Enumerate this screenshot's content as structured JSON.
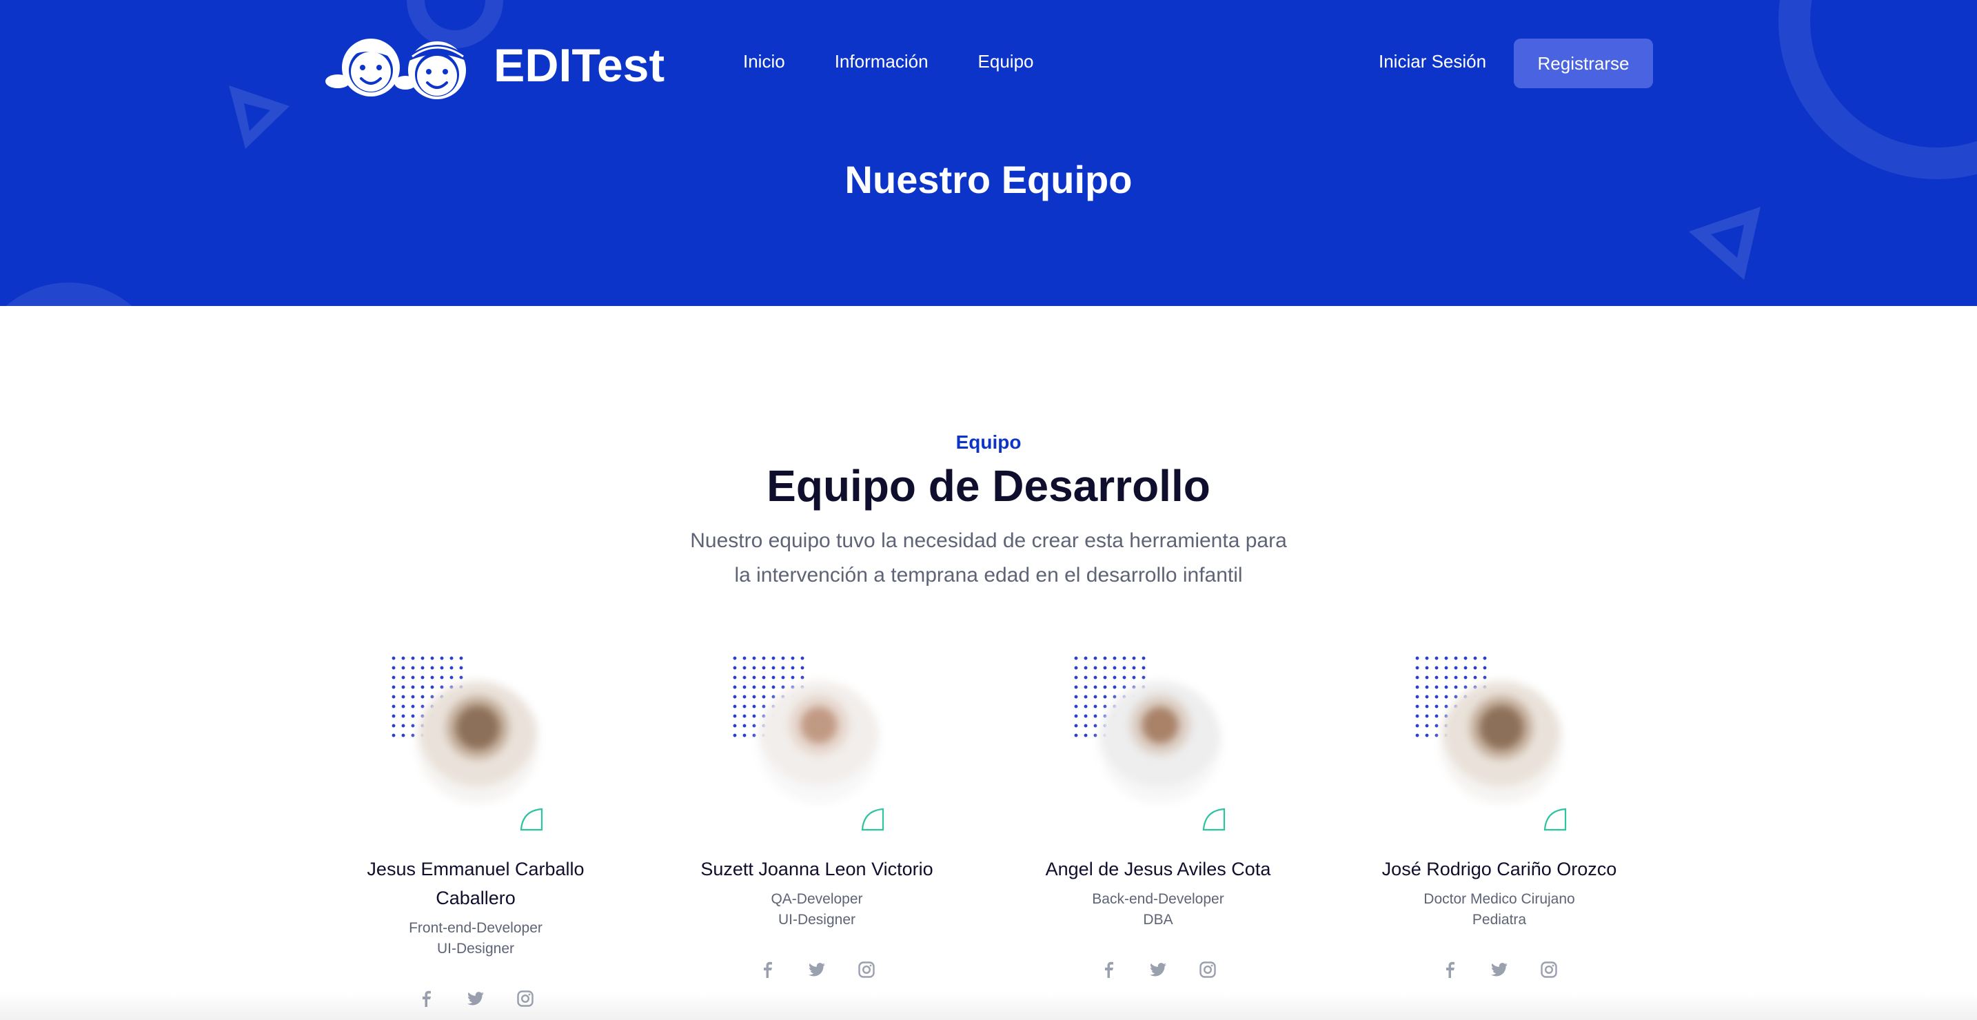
{
  "brand": {
    "name": "EDITest",
    "colors": {
      "primary": "#0d34c9",
      "button": "#4a63e0",
      "accent": "#2ec4a0"
    }
  },
  "nav": {
    "links": [
      "Inicio",
      "Información",
      "Equipo"
    ],
    "login": "Iniciar Sesión",
    "register": "Registrarse"
  },
  "hero": {
    "title": "Nuestro Equipo"
  },
  "section": {
    "eyebrow": "Equipo",
    "title": "Equipo de Desarrollo",
    "description_line1": "Nuestro equipo tuvo la necesidad de crear esta herramienta para",
    "description_line2": "la intervención a temprana edad en el desarrollo infantil"
  },
  "team": [
    {
      "name": "Jesus Emmanuel Carballo Caballero",
      "role1": "Front-end-Developer",
      "role2": "UI-Designer",
      "socials": [
        "facebook-icon",
        "twitter-icon",
        "instagram-icon"
      ]
    },
    {
      "name": "Suzett Joanna Leon Victorio",
      "role1": "QA-Developer",
      "role2": "UI-Designer",
      "socials": [
        "facebook-icon",
        "twitter-icon",
        "instagram-icon"
      ]
    },
    {
      "name": "Angel de Jesus Aviles Cota",
      "role1": "Back-end-Developer",
      "role2": "DBA",
      "socials": [
        "facebook-icon",
        "twitter-icon",
        "instagram-icon"
      ]
    },
    {
      "name": "José Rodrigo Cariño Orozco",
      "role1": "Doctor Medico Cirujano",
      "role2": "Pediatra",
      "socials": [
        "facebook-icon",
        "twitter-icon",
        "instagram-icon"
      ]
    }
  ]
}
